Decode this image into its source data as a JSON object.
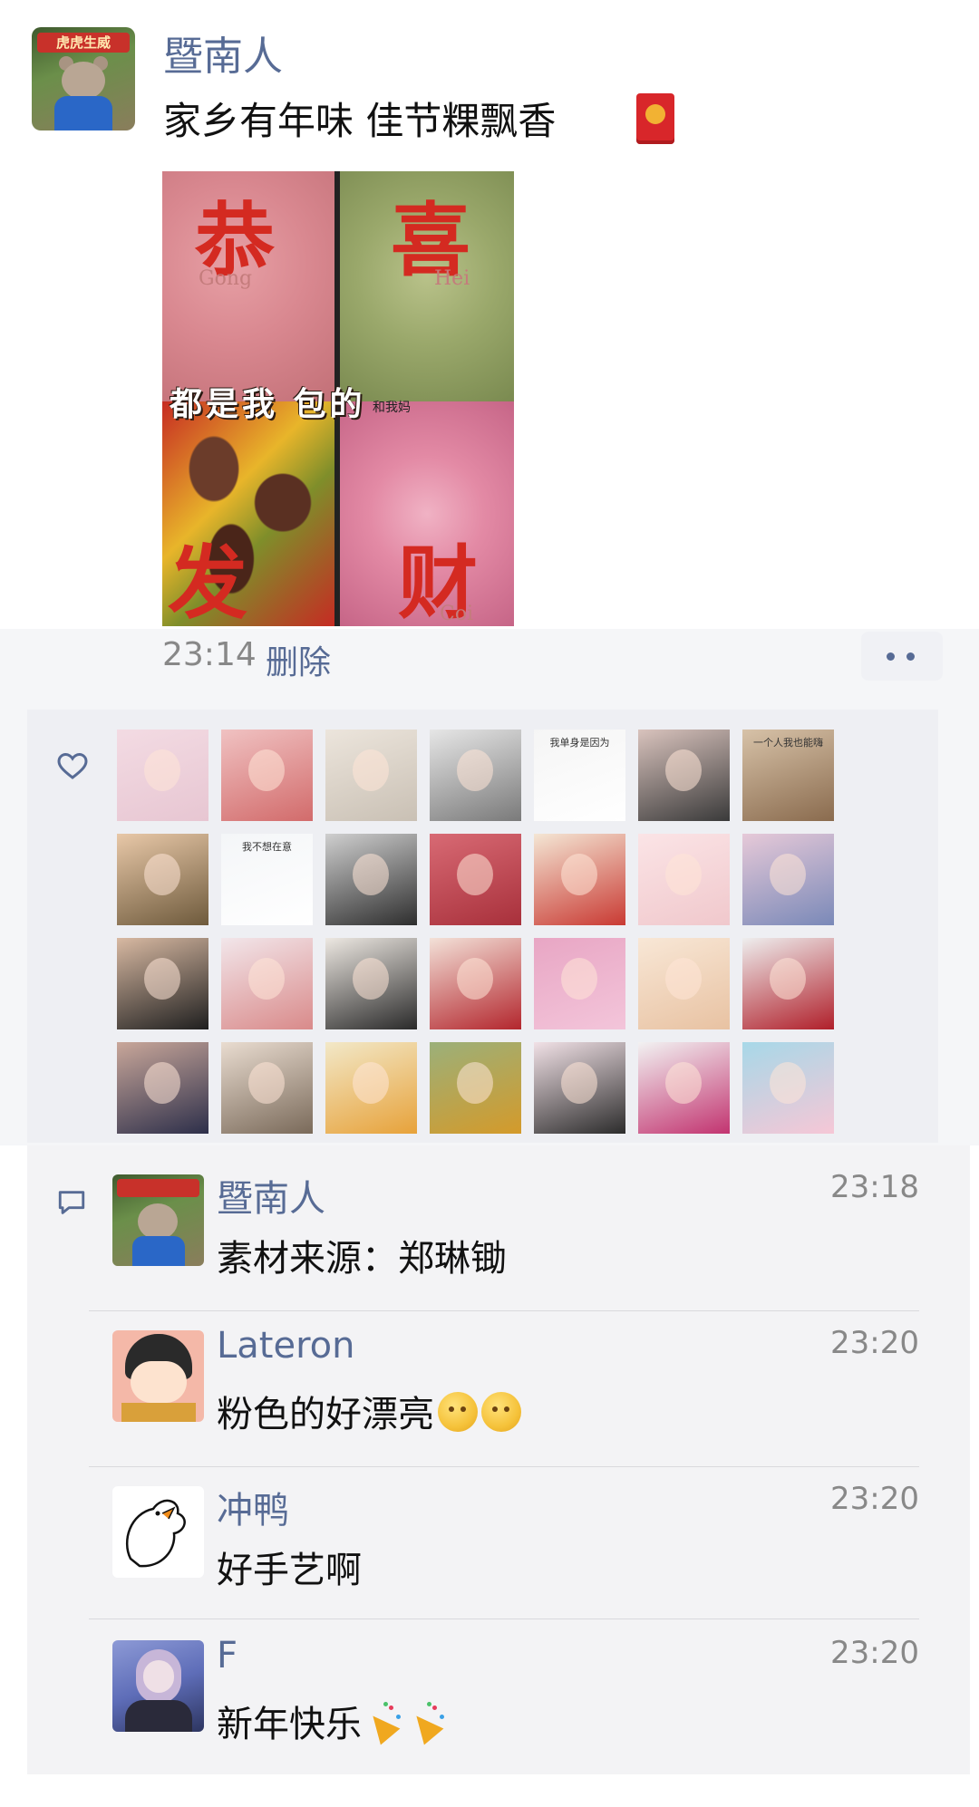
{
  "post": {
    "author": "暨南人",
    "avatar_banner": "虎虎生威",
    "text": "家乡有年味 佳节粿飘香",
    "image": {
      "chars": [
        "恭",
        "喜",
        "发",
        "财"
      ],
      "pinyin": [
        "Gong",
        "Hei",
        "",
        "Coi"
      ],
      "caption": "都是我 包的",
      "caption_small": "和我妈"
    },
    "time": "23:14",
    "delete_label": "删除"
  },
  "likes": {
    "icon": "heart-icon",
    "avatars": [
      {
        "name": "like-avatar-1",
        "colors": [
          "#e7c6d2",
          "#f3dbe3"
        ]
      },
      {
        "name": "like-avatar-2",
        "colors": [
          "#d26b6b",
          "#f0c2c2"
        ]
      },
      {
        "name": "like-avatar-3",
        "colors": [
          "#c9c0b4",
          "#ece5dc"
        ]
      },
      {
        "name": "like-avatar-4",
        "colors": [
          "#7a7a7a",
          "#e6e6e6"
        ]
      },
      {
        "name": "like-avatar-5",
        "colors": [
          "#ffffff",
          "#f5f5f5"
        ],
        "text": "我单身是因为"
      },
      {
        "name": "like-avatar-6",
        "colors": [
          "#3a3a3a",
          "#d9c3bd"
        ]
      },
      {
        "name": "like-avatar-7",
        "colors": [
          "#8a6b4e",
          "#d7c2a8"
        ],
        "text": "一个人我也能嗨"
      },
      {
        "name": "like-avatar-8",
        "colors": [
          "#6e5a3c",
          "#e8c8a8"
        ]
      },
      {
        "name": "like-avatar-9",
        "colors": [
          "#ffffff",
          "#f4f6f8"
        ],
        "text": "我不想在意"
      },
      {
        "name": "like-avatar-10",
        "colors": [
          "#2e2e2e",
          "#cfcfcf"
        ]
      },
      {
        "name": "like-avatar-11",
        "colors": [
          "#a8303b",
          "#d86a74"
        ]
      },
      {
        "name": "like-avatar-12",
        "colors": [
          "#c93a33",
          "#f4e6d4"
        ]
      },
      {
        "name": "like-avatar-13",
        "colors": [
          "#f0c8cc",
          "#fbe4e6"
        ]
      },
      {
        "name": "like-avatar-14",
        "colors": [
          "#7a89b8",
          "#e6c9d8"
        ]
      },
      {
        "name": "like-avatar-15",
        "colors": [
          "#1f1f1f",
          "#d8b9a2"
        ]
      },
      {
        "name": "like-avatar-16",
        "colors": [
          "#d98a8a",
          "#f2e6ea"
        ]
      },
      {
        "name": "like-avatar-17",
        "colors": [
          "#2a2a2a",
          "#ede8e2"
        ]
      },
      {
        "name": "like-avatar-18",
        "colors": [
          "#b3262d",
          "#f3e1d8"
        ]
      },
      {
        "name": "like-avatar-19",
        "colors": [
          "#f3c5da",
          "#e8a6c4"
        ]
      },
      {
        "name": "like-avatar-20",
        "colors": [
          "#e8c2a2",
          "#f8e7d6"
        ]
      },
      {
        "name": "like-avatar-21",
        "colors": [
          "#b01f2a",
          "#eeeeee"
        ]
      },
      {
        "name": "like-avatar-22",
        "colors": [
          "#2d2f4a",
          "#c9a79a"
        ]
      },
      {
        "name": "like-avatar-23",
        "colors": [
          "#7a6a5a",
          "#e9dcd0"
        ]
      },
      {
        "name": "like-avatar-24",
        "colors": [
          "#e7a23a",
          "#f2e8c8"
        ]
      },
      {
        "name": "like-avatar-25",
        "colors": [
          "#d49a2a",
          "#9bb07a"
        ]
      },
      {
        "name": "like-avatar-26",
        "colors": [
          "#2c2c2c",
          "#f1e1e6"
        ]
      },
      {
        "name": "like-avatar-27",
        "colors": [
          "#c23470",
          "#f2f2f2"
        ]
      },
      {
        "name": "like-avatar-28",
        "colors": [
          "#f6c7d6",
          "#a7d8e8"
        ]
      }
    ]
  },
  "comments": {
    "icon": "comment-bubble-icon",
    "items": [
      {
        "name": "暨南人",
        "time": "23:18",
        "text": "素材来源：郑琳锄",
        "emoji": "",
        "avatar": "bear"
      },
      {
        "name": "Lateron",
        "time": "23:20",
        "text": "粉色的好漂亮",
        "emoji": "face",
        "avatar": "maruko"
      },
      {
        "name": "冲鸭",
        "time": "23:20",
        "text": "好手艺啊",
        "emoji": "",
        "avatar": "duck"
      },
      {
        "name": "F",
        "time": "23:20",
        "text": "新年快乐",
        "emoji": "party",
        "avatar": "girl"
      }
    ]
  },
  "colors": {
    "link": "#576b95",
    "meta": "#888888",
    "panel": "#eeeff3"
  }
}
